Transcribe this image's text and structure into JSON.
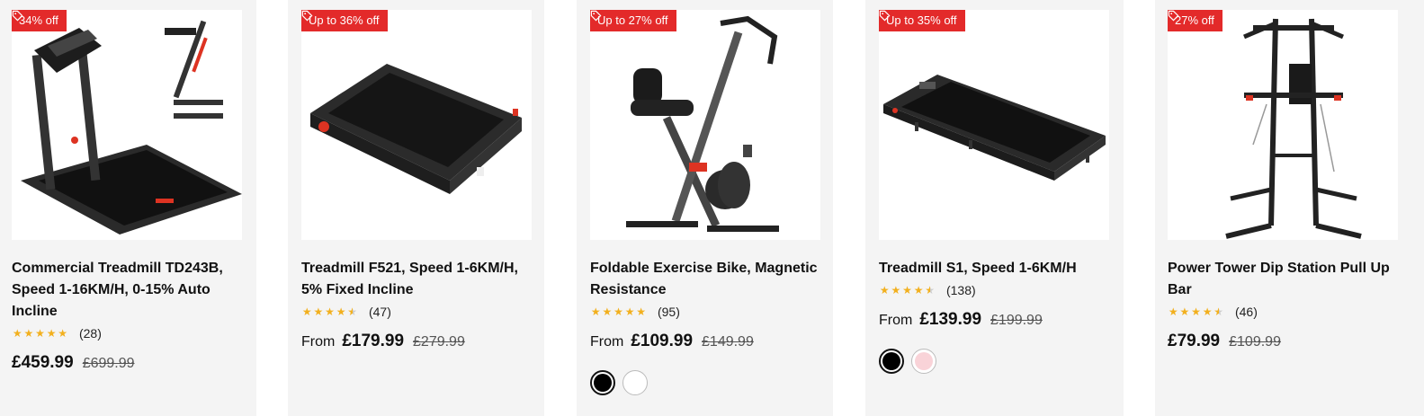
{
  "products": [
    {
      "badge": "34% off",
      "title": "Commercial Treadmill TD243B, Speed 1-16KM/H, 0-15% Auto Incline",
      "rating": 5,
      "reviews": "(28)",
      "from": "",
      "price": "£459.99",
      "was": "£699.99",
      "swatches": []
    },
    {
      "badge": "Up to 36% off",
      "title": "Treadmill F521, Speed 1-6KM/H, 5% Fixed Incline",
      "rating": 4.5,
      "reviews": "(47)",
      "from": "From",
      "price": "£179.99",
      "was": "£279.99",
      "swatches": []
    },
    {
      "badge": "Up to 27% off",
      "title": "Foldable Exercise Bike, Magnetic Resistance",
      "rating": 5,
      "reviews": "(95)",
      "from": "From",
      "price": "£109.99",
      "was": "£149.99",
      "swatches": [
        "#000000",
        "#ffffff"
      ]
    },
    {
      "badge": "Up to 35% off",
      "title": "Treadmill S1, Speed 1-6KM/H",
      "rating": 4.5,
      "reviews": "(138)",
      "from": "From",
      "price": "£139.99",
      "was": "£199.99",
      "swatches": [
        "#000000",
        "#f9d3d8"
      ]
    },
    {
      "badge": "27% off",
      "title": "Power Tower Dip Station Pull Up Bar",
      "rating": 4.5,
      "reviews": "(46)",
      "from": "",
      "price": "£79.99",
      "was": "£109.99",
      "swatches": []
    }
  ],
  "colors": {
    "badge": "#e32a2a",
    "card_bg": "#f4f4f4",
    "star": "#f2b01e"
  }
}
